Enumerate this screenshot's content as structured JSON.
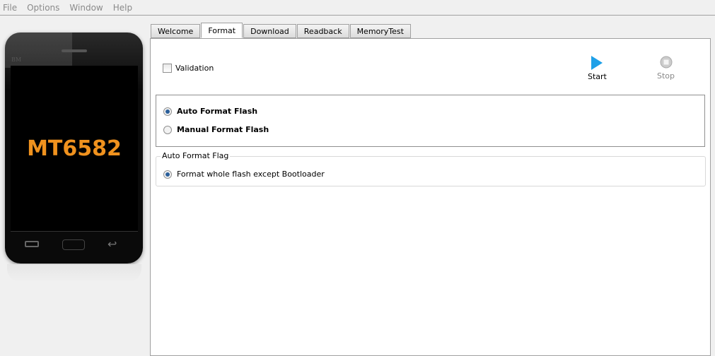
{
  "menu": [
    "File",
    "Options",
    "Window",
    "Help"
  ],
  "phone": {
    "brand": "BM",
    "chip": "MT6582"
  },
  "tabs": [
    "Welcome",
    "Format",
    "Download",
    "Readback",
    "MemoryTest"
  ],
  "active_tab": "Format",
  "format": {
    "validation_label": "Validation",
    "validation_checked": false,
    "start_label": "Start",
    "stop_label": "Stop",
    "auto_format_label": "Auto Format Flash",
    "manual_format_label": "Manual Format Flash",
    "selected_mode": "Auto Format Flash",
    "flag_group_title": "Auto Format Flag",
    "flag_option": "Format whole flash except Bootloader"
  }
}
